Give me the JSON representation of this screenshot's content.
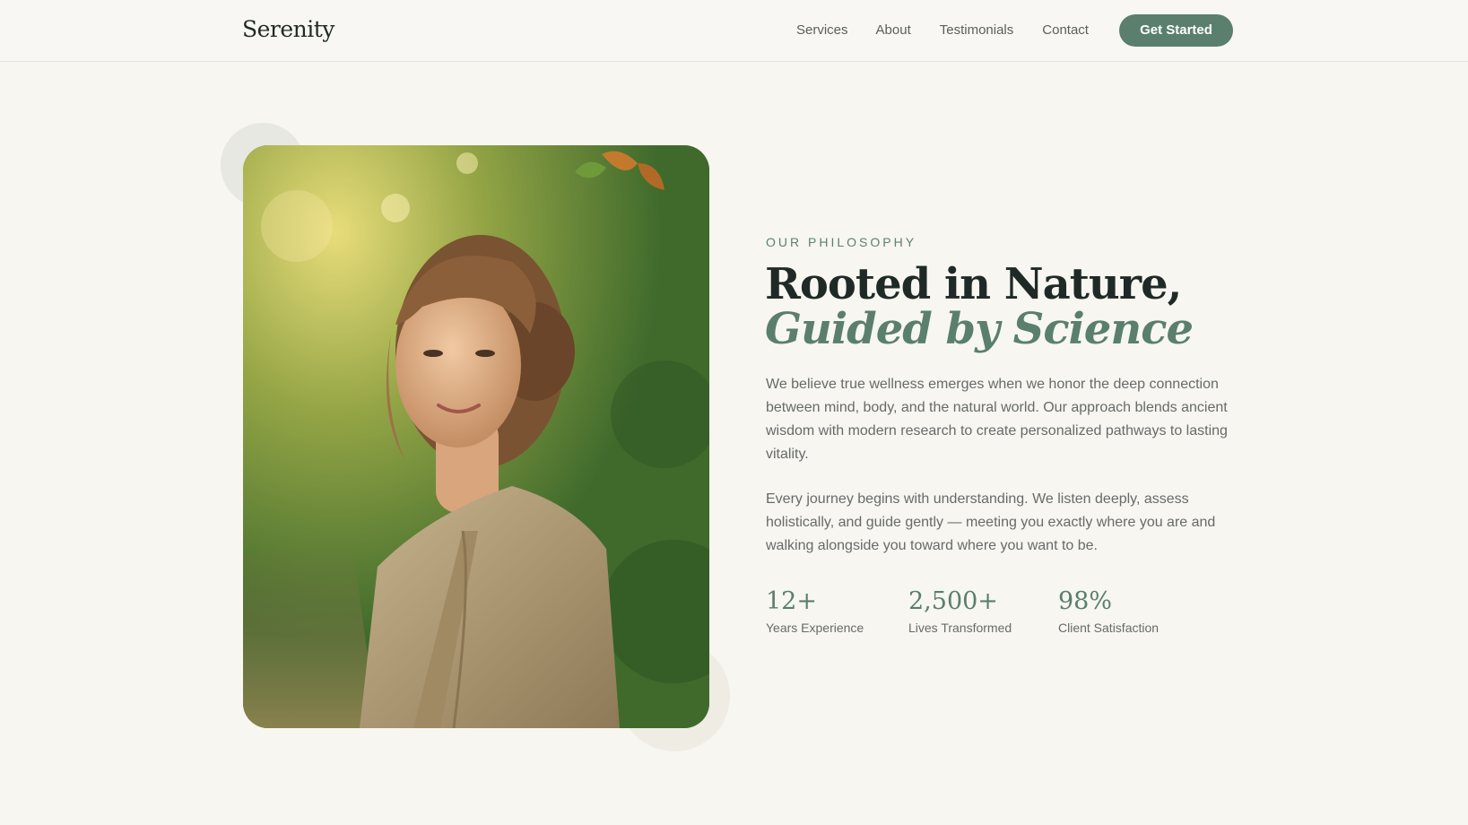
{
  "brand": {
    "logo": "Serenity",
    "accent": "#5a7f6d",
    "background": "#f7f6f1"
  },
  "nav": {
    "items": [
      "Services",
      "About",
      "Testimonials",
      "Contact"
    ],
    "cta_label": "Get Started"
  },
  "hero": {
    "image_icon": "portrait-photo",
    "eyebrow": "OUR PHILOSOPHY",
    "headline_line1": "Rooted in Nature,",
    "headline_line2": "Guided by Science",
    "paragraph1": "We believe true wellness emerges when we honor the deep connection between mind, body, and the natural world. Our approach blends ancient wisdom with modern research to create personalized pathways to lasting vitality.",
    "paragraph2": "Every journey begins with understanding. We listen deeply, assess holistically, and guide gently — meeting you exactly where you are and walking alongside you toward where you want to be.",
    "stats": [
      {
        "value": "12+",
        "label": "Years Experience"
      },
      {
        "value": "2,500+",
        "label": "Lives Transformed"
      },
      {
        "value": "98%",
        "label": "Client Satisfaction"
      }
    ]
  }
}
